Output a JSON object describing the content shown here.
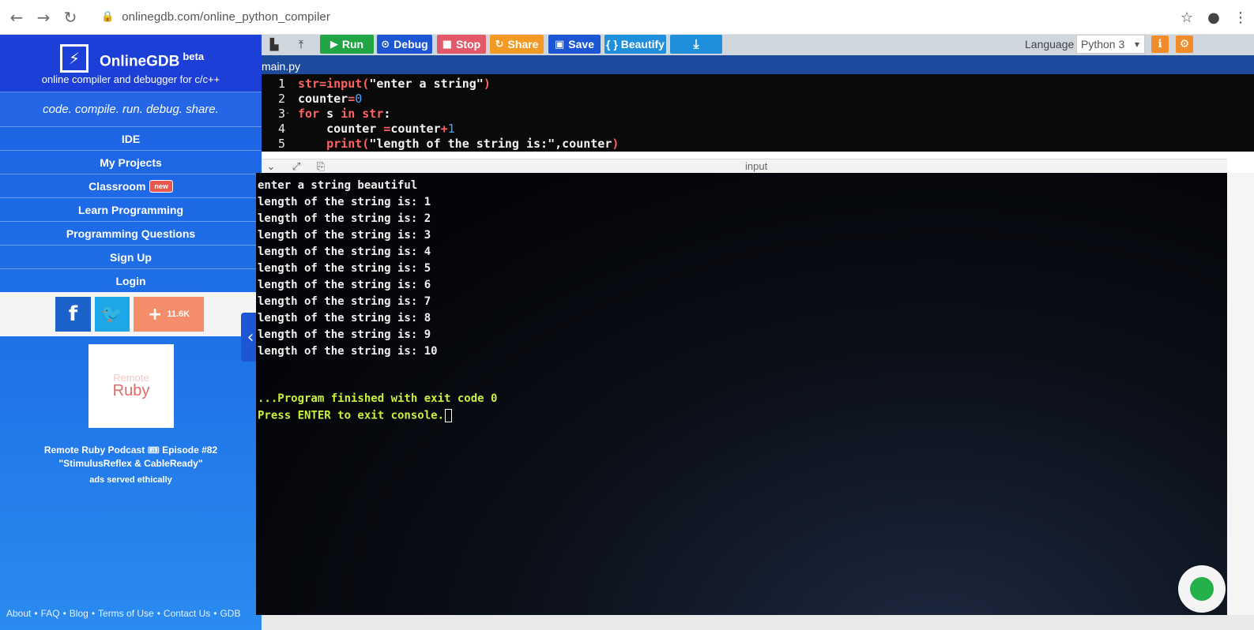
{
  "browser": {
    "url": "onlinegdb.com/online_python_compiler",
    "back_icon": "←",
    "forward_icon": "→",
    "reload_icon": "↻",
    "lock_icon": "🔒",
    "star_icon": "☆",
    "account_icon": "●",
    "menu_icon": "⋮"
  },
  "sidebar": {
    "brand": "OnlineGDB",
    "beta": "beta",
    "logo_icon": "⚡",
    "tagline": "online compiler and debugger for c/c++",
    "motto": "code. compile. run. debug. share.",
    "menu": [
      {
        "label": "IDE"
      },
      {
        "label": "My Projects"
      },
      {
        "label": "Classroom",
        "badge": "new"
      },
      {
        "label": "Learn Programming"
      },
      {
        "label": "Programming Questions"
      },
      {
        "label": "Sign Up"
      },
      {
        "label": "Login"
      }
    ],
    "social": {
      "facebook": "f",
      "twitter": "🐦",
      "share_plus": "+",
      "share_count": "11.6K"
    },
    "ad": {
      "image_faded": "Remote",
      "image_title": "Ruby",
      "line1": "Remote Ruby Podcast 🎟 Episode #82",
      "line2": "\"StimulusReflex & CableReady\"",
      "ethical": "ads served ethically"
    },
    "footer": [
      "About",
      "FAQ",
      "Blog",
      "Terms of Use",
      "Contact Us",
      "GDB"
    ],
    "footer_sep": "•",
    "collapse_icon": "‹"
  },
  "toolbar": {
    "new_icon": "▙",
    "upload_icon": "⤒",
    "run_icon": "▶",
    "run": "Run",
    "debug_icon": "⊙",
    "debug": "Debug",
    "stop_icon": "■",
    "stop": "Stop",
    "share_icon": "↻",
    "share": "Share",
    "save_icon": "▣",
    "save": "Save",
    "beautify": "{ } Beautify",
    "download_icon": "⤓",
    "language_label": "Language",
    "language_value": "Python 3",
    "caret": "▼",
    "info_icon": "ℹ",
    "settings_icon": "⚙"
  },
  "editor": {
    "file_tab": "main.py",
    "lines": [
      {
        "n": "1",
        "fold": "",
        "parts": [
          [
            "kw",
            "str=input("
          ],
          [
            "str",
            "\"enter a string\""
          ],
          [
            "kw",
            ")"
          ]
        ]
      },
      {
        "n": "2",
        "fold": "",
        "parts": [
          [
            "bold",
            "counter"
          ],
          [
            "kw",
            "="
          ],
          [
            "num",
            "0"
          ]
        ]
      },
      {
        "n": "3",
        "fold": "-",
        "parts": [
          [
            "kw",
            "for "
          ],
          [
            "bold",
            "s "
          ],
          [
            "kw",
            "in "
          ],
          [
            "kw",
            "str"
          ],
          [
            "bold",
            ":"
          ]
        ]
      },
      {
        "n": "4",
        "fold": "",
        "parts": [
          [
            "bold",
            "    counter "
          ],
          [
            "kw",
            "="
          ],
          [
            "bold",
            "counter"
          ],
          [
            "kw",
            "+"
          ],
          [
            "num",
            "1"
          ]
        ]
      },
      {
        "n": "5",
        "fold": "",
        "parts": [
          [
            "kw",
            "    print("
          ],
          [
            "str",
            "\"length of the string is:\""
          ],
          [
            "bold",
            ",counter"
          ],
          [
            "kw",
            ")"
          ]
        ]
      }
    ]
  },
  "io": {
    "label": "input",
    "collapse_icon": "⌄",
    "expand_icon": "⤢",
    "copy_icon": "⎘"
  },
  "console": {
    "lines": [
      "enter a string beautiful",
      "length of the string is: 1",
      "length of the string is: 2",
      "length of the string is: 3",
      "length of the string is: 4",
      "length of the string is: 5",
      "length of the string is: 6",
      "length of the string is: 7",
      "length of the string is: 8",
      "length of the string is: 9",
      "length of the string is: 10"
    ],
    "finished": "...Program finished with exit code 0",
    "press_enter": "Press ENTER to exit console."
  }
}
